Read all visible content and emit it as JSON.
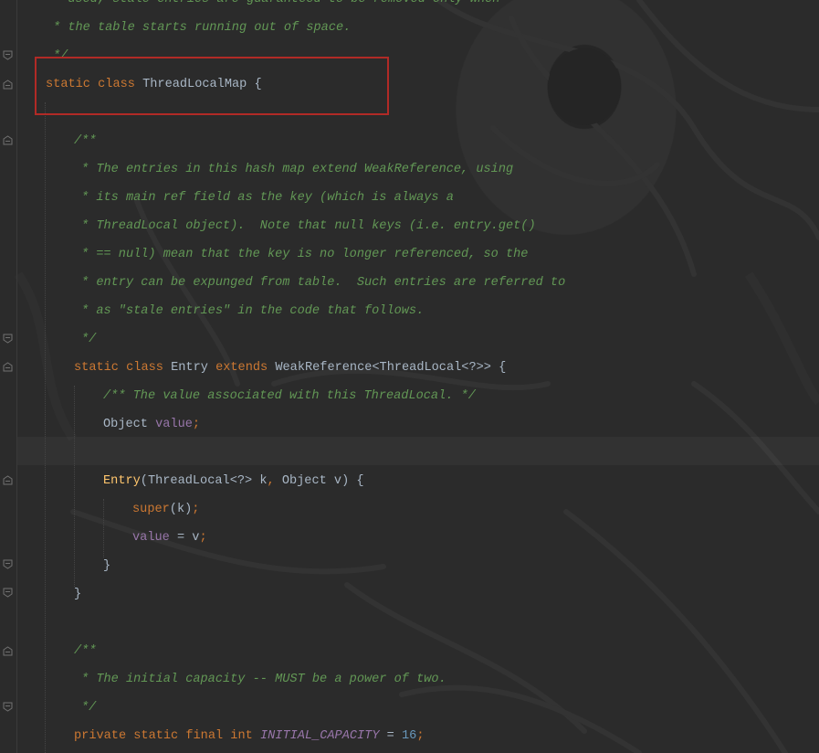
{
  "code": {
    "l1": "* used, stale entries are guaranteed to be removed only when",
    "l2": "* the table starts running out of space.",
    "l3": "*/",
    "l4_kw1": "static",
    "l4_kw2": "class",
    "l4_name": "ThreadLocalMap",
    "l4_brace": "{",
    "l6": "/**",
    "l7": "* The entries in this hash map extend WeakReference, using",
    "l8": "* its main ref field as the key (which is always a",
    "l9": "* ThreadLocal object).  Note that null keys (i.e. entry.get()",
    "l10": "* == null) mean that the key is no longer referenced, so the",
    "l11": "* entry can be expunged from table.  Such entries are referred to",
    "l12": "* as \"stale entries\" in the code that follows.",
    "l13": "*/",
    "l14_kw1": "static",
    "l14_kw2": "class",
    "l14_name": "Entry",
    "l14_kw3": "extends",
    "l14_super": "WeakReference<ThreadLocal<?>>",
    "l14_brace": "{",
    "l15": "/** The value associated with this ThreadLocal. */",
    "l16_type": "Object",
    "l16_field": "value",
    "l16_semi": ";",
    "l18_method": "Entry",
    "l18_params_a": "(ThreadLocal<?> k",
    "l18_comma": ",",
    "l18_params_b": " Object v) {",
    "l19_kw": "super",
    "l19_rest": "(k)",
    "l19_semi": ";",
    "l20_field": "value",
    "l20_rest": " = v",
    "l20_semi": ";",
    "l21": "}",
    "l22": "}",
    "l24": "/**",
    "l25": "* The initial capacity -- MUST be a power of two.",
    "l26": "*/",
    "l27_kw": "private static final int",
    "l27_const": "INITIAL_CAPACITY",
    "l27_eq": " = ",
    "l27_num": "16",
    "l27_semi": ";"
  },
  "colors": {
    "background": "#2b2b2b",
    "comment": "#629755",
    "keyword": "#cc7832",
    "identifier": "#a9b7c6",
    "field": "#9876aa",
    "number": "#6897bb",
    "method": "#ffc66d",
    "highlight_box": "#b12a26"
  },
  "icons": {
    "fold_open": "fold-marker-open-icon",
    "fold_close": "fold-marker-close-icon"
  }
}
